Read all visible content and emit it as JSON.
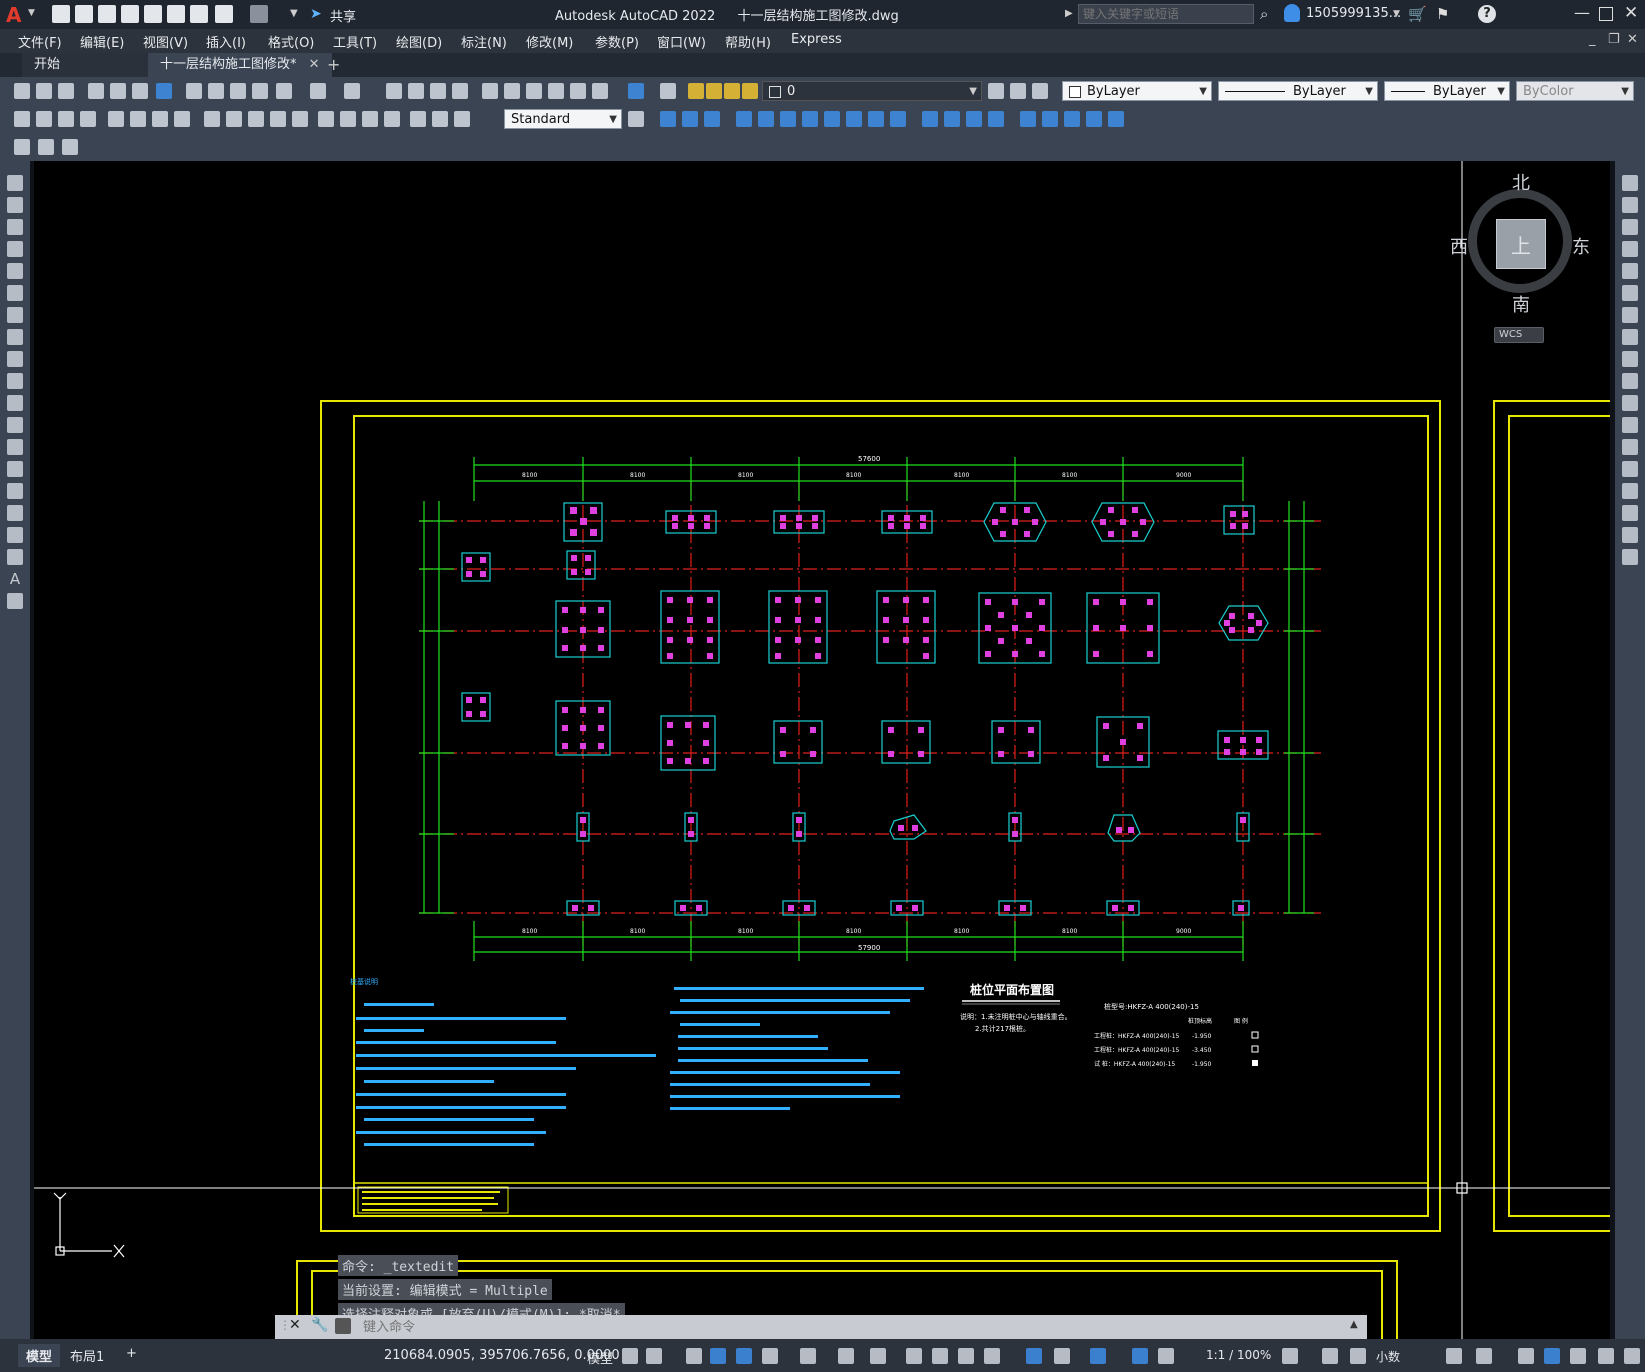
{
  "app": {
    "title": "Autodesk AutoCAD 2022",
    "document": "十一层结构施工图修改.dwg",
    "share_label": "共享",
    "search_placeholder": "键入关键字或短语",
    "user": "1505999135...",
    "accent": "#1a9fe0"
  },
  "menu": [
    "文件(F)",
    "编辑(E)",
    "视图(V)",
    "插入(I)",
    "格式(O)",
    "工具(T)",
    "绘图(D)",
    "标注(N)",
    "修改(M)",
    "参数(P)",
    "窗口(W)",
    "帮助(H)",
    "Express"
  ],
  "tabs": {
    "start": "开始",
    "active": "十一层结构施工图修改*",
    "close": "✕",
    "add": "+"
  },
  "toolbar": {
    "layer_value": "0",
    "color_value": "ByLayer",
    "linetype_value": "ByLayer",
    "lineweight_value": "ByLayer",
    "plotstyle_value": "ByColor",
    "dimstyle_value": "Standard"
  },
  "viewcube": {
    "north": "北",
    "south": "南",
    "east": "东",
    "west": "西",
    "top": "上",
    "wcs": "WCS"
  },
  "drawing": {
    "title": "桩位平面布置图",
    "note_header": "说明：1.未注明桩中心与轴线重合。",
    "note_2": "2.共计217根桩。",
    "general_notes_title": "桩基说明",
    "pile_type": "桩型号:HKFZ-A 400(240)-15",
    "legend_header": [
      "桩顶标高",
      "图 例"
    ],
    "legend": [
      {
        "label": "工程桩：HKFZ-A 400(240)-15",
        "elev": "-1.950"
      },
      {
        "label": "工程桩：HKFZ-A 400(240)-15",
        "elev": "-3.450"
      },
      {
        "label": "试 桩：HKFZ-A 400(240)-15",
        "elev": "-1.950"
      }
    ],
    "dims_top": [
      "8100",
      "8100",
      "8100",
      "8100",
      "8100",
      "8100",
      "9000"
    ],
    "dims_total": "57600",
    "dims_bottom": [
      "8100",
      "8100",
      "8100",
      "8100",
      "8100",
      "8100",
      "9000"
    ],
    "dims_total_bottom": "57900"
  },
  "command": {
    "history": [
      "命令: _textedit",
      "当前设置: 编辑模式 = Multiple",
      "选择注释对象或 [放弃(U)/模式(M)]: *取消*"
    ],
    "placeholder": "键入命令"
  },
  "status": {
    "layout_tabs": [
      "模型",
      "布局1"
    ],
    "add_tab": "+",
    "coords": "210684.0905, 395706.7656, 0.0000",
    "model": "模型",
    "scale": "1:1 / 100%",
    "units": "小数"
  }
}
